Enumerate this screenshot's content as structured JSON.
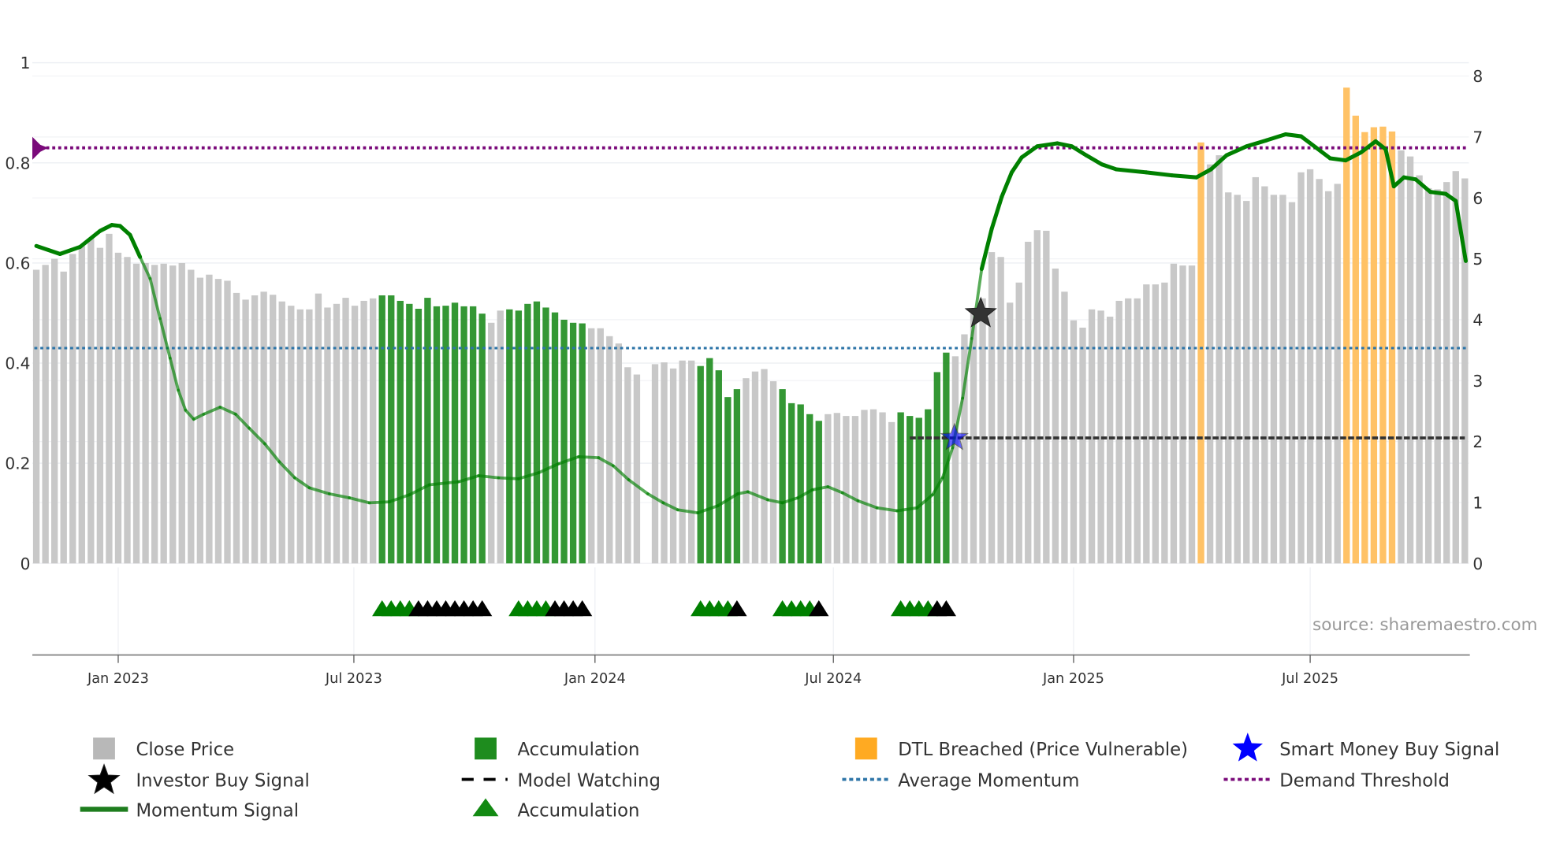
{
  "chart_data": {
    "type": "bar",
    "title": "",
    "x_start": "2022-10-31",
    "frequency": "weekly",
    "left_axis": {
      "ylim": [
        0,
        1
      ],
      "ticks": [
        "0",
        "0.2",
        "0.4",
        "0.6",
        "0.8",
        "1"
      ]
    },
    "right_axis": {
      "ylim": [
        0,
        8
      ],
      "ticks": [
        "0",
        "1",
        "2",
        "3",
        "4",
        "5",
        "6",
        "7",
        "8"
      ]
    },
    "x_ticks": [
      {
        "label": "Jan 2023",
        "week": 9
      },
      {
        "label": "Jul 2023",
        "week": 34.9
      },
      {
        "label": "Jan 2024",
        "week": 61.4
      },
      {
        "label": "Jul 2024",
        "week": 87.6
      },
      {
        "label": "Jan 2025",
        "week": 114
      },
      {
        "label": "Jul 2025",
        "week": 140
      }
    ],
    "close_price": [
      4.82,
      4.9,
      5.0,
      4.79,
      5.08,
      5.21,
      5.33,
      5.18,
      5.41,
      5.1,
      5.03,
      4.92,
      4.93,
      4.9,
      4.92,
      4.89,
      4.93,
      4.82,
      4.69,
      4.74,
      4.67,
      4.64,
      4.44,
      4.33,
      4.4,
      4.46,
      4.41,
      4.3,
      4.23,
      4.17,
      4.17,
      4.43,
      4.2,
      4.26,
      4.36,
      4.23,
      4.31,
      4.35,
      4.4,
      4.4,
      4.31,
      4.26,
      4.18,
      4.36,
      4.22,
      4.23,
      4.28,
      4.22,
      4.22,
      4.1,
      3.95,
      4.15,
      4.17,
      4.15,
      4.26,
      4.3,
      4.2,
      4.12,
      4.0,
      3.95,
      3.94,
      3.86,
      3.86,
      3.73,
      3.61,
      3.22,
      3.1,
      null,
      3.27,
      3.3,
      3.2,
      3.33,
      3.33,
      3.24,
      3.37,
      3.17,
      2.73,
      2.86,
      3.04,
      3.15,
      3.19,
      2.99,
      2.86,
      2.63,
      2.61,
      2.45,
      2.34,
      2.45,
      2.47,
      2.42,
      2.42,
      2.52,
      2.53,
      2.48,
      2.32,
      2.48,
      2.42,
      2.39,
      2.53,
      3.14,
      3.46,
      3.4,
      3.76,
      4.1,
      4.35,
      5.11,
      5.03,
      4.28,
      4.61,
      5.28,
      5.47,
      5.46,
      4.84,
      4.46,
      3.99,
      3.87,
      4.17,
      4.15,
      4.05,
      4.31,
      4.35,
      4.35,
      4.58,
      4.58,
      4.61,
      4.92,
      4.89,
      4.89,
      6.91,
      6.55,
      6.7,
      6.09,
      6.05,
      5.95,
      6.34,
      6.19,
      6.05,
      6.05,
      5.93,
      6.42,
      6.47,
      6.31,
      6.11,
      6.23,
      7.81,
      7.35,
      7.08,
      7.16,
      7.17,
      7.09,
      6.78,
      6.68,
      6.37,
      6.16,
      6.14,
      6.26,
      6.44,
      6.32
    ],
    "accumulation_ranges": [
      [
        38,
        49
      ],
      [
        52,
        60
      ],
      [
        73,
        77
      ],
      [
        82,
        86
      ],
      [
        95,
        100
      ]
    ],
    "dtl_breached_ranges": [
      [
        128,
        128
      ],
      [
        144,
        149
      ]
    ],
    "momentum_signal": [
      [
        0,
        0.634
      ],
      [
        2.6,
        0.618
      ],
      [
        4.8,
        0.632
      ],
      [
        7,
        0.664
      ],
      [
        8.3,
        0.676
      ],
      [
        9.2,
        0.674
      ],
      [
        10.3,
        0.656
      ],
      [
        11.4,
        0.612
      ],
      [
        12.5,
        0.569
      ],
      [
        13.6,
        0.489
      ],
      [
        14.7,
        0.41
      ],
      [
        15.6,
        0.346
      ],
      [
        16.4,
        0.306
      ],
      [
        17.3,
        0.288
      ],
      [
        18.4,
        0.298
      ],
      [
        20.2,
        0.312
      ],
      [
        21.9,
        0.298
      ],
      [
        23.4,
        0.27
      ],
      [
        25.1,
        0.239
      ],
      [
        26.7,
        0.203
      ],
      [
        28.4,
        0.171
      ],
      [
        30,
        0.151
      ],
      [
        32.2,
        0.139
      ],
      [
        34.4,
        0.131
      ],
      [
        36.6,
        0.121
      ],
      [
        38.8,
        0.123
      ],
      [
        41,
        0.137
      ],
      [
        43.2,
        0.157
      ],
      [
        46.4,
        0.163
      ],
      [
        48.6,
        0.175
      ],
      [
        50.8,
        0.171
      ],
      [
        53,
        0.169
      ],
      [
        55.2,
        0.181
      ],
      [
        57.4,
        0.199
      ],
      [
        59.6,
        0.213
      ],
      [
        61.8,
        0.211
      ],
      [
        63.4,
        0.195
      ],
      [
        65.1,
        0.167
      ],
      [
        67.2,
        0.139
      ],
      [
        68.9,
        0.121
      ],
      [
        70.5,
        0.107
      ],
      [
        72.7,
        0.101
      ],
      [
        74.9,
        0.115
      ],
      [
        77.1,
        0.139
      ],
      [
        78.2,
        0.143
      ],
      [
        80.4,
        0.127
      ],
      [
        82,
        0.121
      ],
      [
        83.7,
        0.131
      ],
      [
        85.3,
        0.147
      ],
      [
        87,
        0.153
      ],
      [
        88.6,
        0.141
      ],
      [
        90.3,
        0.125
      ],
      [
        92.4,
        0.111
      ],
      [
        94.6,
        0.105
      ],
      [
        96.8,
        0.111
      ],
      [
        98.5,
        0.137
      ],
      [
        99.6,
        0.171
      ],
      [
        100.7,
        0.231
      ],
      [
        101.8,
        0.33
      ],
      [
        102.8,
        0.449
      ],
      [
        103.9,
        0.588
      ],
      [
        105,
        0.668
      ],
      [
        106.1,
        0.732
      ],
      [
        107.2,
        0.781
      ],
      [
        108.3,
        0.811
      ],
      [
        110,
        0.833
      ],
      [
        112.2,
        0.839
      ],
      [
        113.8,
        0.833
      ],
      [
        115.4,
        0.815
      ],
      [
        117.1,
        0.797
      ],
      [
        118.7,
        0.787
      ],
      [
        122,
        0.781
      ],
      [
        124.8,
        0.775
      ],
      [
        127.5,
        0.771
      ],
      [
        129.1,
        0.787
      ],
      [
        130.8,
        0.815
      ],
      [
        133,
        0.833
      ],
      [
        135.2,
        0.845
      ],
      [
        137.3,
        0.857
      ],
      [
        139,
        0.853
      ],
      [
        140.6,
        0.831
      ],
      [
        142.2,
        0.809
      ],
      [
        143.9,
        0.805
      ],
      [
        145.6,
        0.821
      ],
      [
        147.2,
        0.843
      ],
      [
        148.3,
        0.827
      ],
      [
        149.2,
        0.753
      ],
      [
        150.3,
        0.771
      ],
      [
        151.6,
        0.767
      ],
      [
        153.2,
        0.742
      ],
      [
        154.9,
        0.738
      ],
      [
        156,
        0.724
      ],
      [
        157.1,
        0.604
      ]
    ],
    "average_momentum": 0.43,
    "demand_threshold": 0.83,
    "model_watching": {
      "from_week": 96,
      "to_week": 157,
      "value": 2.06
    },
    "smart_money_buy_signal": {
      "week": 100.9,
      "value": 2.06
    },
    "investor_buy_signal": {
      "week": 103.8,
      "value": 4.1
    },
    "accumulation_markers_green": [
      38,
      39,
      40,
      41,
      53,
      54,
      55,
      56,
      73,
      74,
      75,
      76,
      82,
      83,
      84,
      85,
      95,
      96,
      97,
      98
    ],
    "accumulation_markers_black": [
      42,
      43,
      44,
      45,
      46,
      47,
      48,
      49,
      57,
      58,
      59,
      60,
      77,
      86,
      99,
      100
    ],
    "colors": {
      "close": "#c8c8c8",
      "accumulation": "#1e8c1e",
      "dtl": "#ffc266",
      "momentum": "#008000",
      "avg": "#2e75a8",
      "threshold": "#7a0a7a",
      "smart": "#0000ff"
    },
    "source": "source: sharemaestro.com",
    "legend": [
      {
        "label": "Close Price",
        "icon": "gray-square"
      },
      {
        "label": "Accumulation",
        "icon": "green-square"
      },
      {
        "label": "DTL Breached (Price Vulnerable)",
        "icon": "orange-square"
      },
      {
        "label": "Smart Money Buy Signal",
        "icon": "blue-star"
      },
      {
        "label": "Investor Buy Signal",
        "icon": "black-star"
      },
      {
        "label": "Model Watching",
        "icon": "black-dash"
      },
      {
        "label": "Average Momentum",
        "icon": "blue-dot-line"
      },
      {
        "label": "Demand Threshold",
        "icon": "purple-dot-line"
      },
      {
        "label": "Momentum Signal",
        "icon": "green-line"
      },
      {
        "label": "Accumulation",
        "icon": "green-triangle"
      }
    ]
  }
}
